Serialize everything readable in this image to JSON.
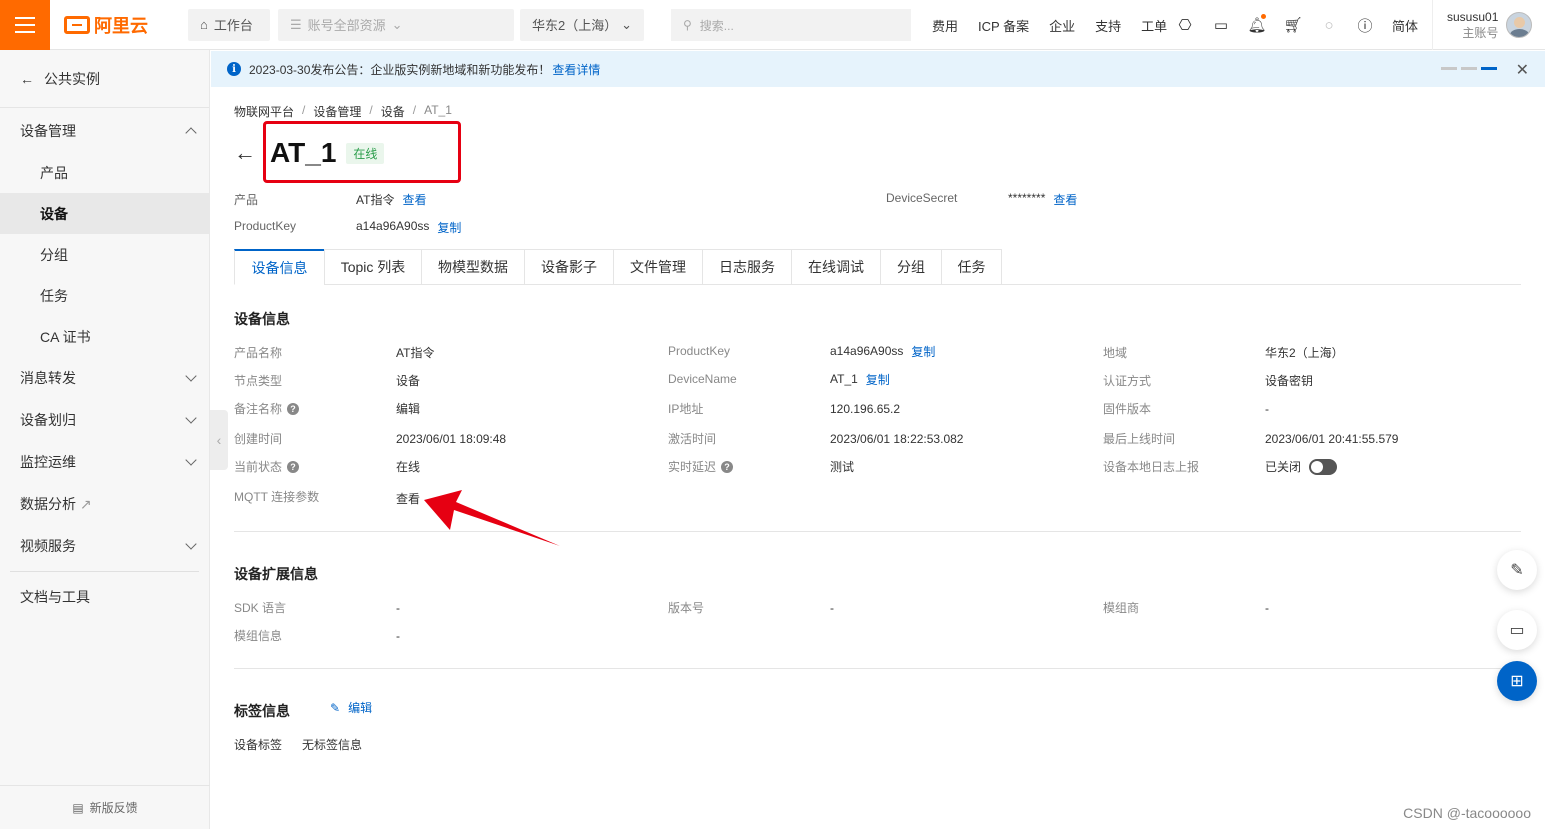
{
  "topbar": {
    "workspace": "工作台",
    "account_scope": "账号全部资源",
    "region": "华东2（上海）",
    "search_placeholder": "搜索...",
    "links": [
      "费用",
      "ICP 备案",
      "企业",
      "支持",
      "工单"
    ],
    "lang": "简体",
    "user_name": "sususu01",
    "user_role": "主账号",
    "logo_text": "阿里云"
  },
  "sidebar": {
    "back": "公共实例",
    "group_device": "设备管理",
    "items": [
      "产品",
      "设备",
      "分组",
      "任务",
      "CA 证书"
    ],
    "groups": [
      "消息转发",
      "设备划归",
      "监控运维",
      "数据分析",
      "视频服务"
    ],
    "docs": "文档与工具",
    "feedback": "新版反馈"
  },
  "notice": {
    "text": "2023-03-30发布公告：企业版实例新地域和新功能发布！",
    "link": "查看详情"
  },
  "breadcrumb": [
    "物联网平台",
    "设备管理",
    "设备",
    "AT_1"
  ],
  "device": {
    "name": "AT_1",
    "status": "在线",
    "product_label": "产品",
    "product_value": "AT指令",
    "product_link": "查看",
    "productkey_label": "ProductKey",
    "productkey_value": "a14a96A90ss",
    "copy": "复制",
    "secret_label": "DeviceSecret",
    "secret_value": "********",
    "secret_link": "查看"
  },
  "tabs": [
    "设备信息",
    "Topic 列表",
    "物模型数据",
    "设备影子",
    "文件管理",
    "日志服务",
    "在线调试",
    "分组",
    "任务"
  ],
  "info": {
    "title": "设备信息",
    "col1": [
      {
        "label": "产品名称",
        "value": "AT指令"
      },
      {
        "label": "节点类型",
        "value": "设备"
      },
      {
        "label": "备注名称",
        "value": "编辑"
      },
      {
        "label": "创建时间",
        "value": "2023/06/01 18:09:48"
      },
      {
        "label": "当前状态",
        "value": "在线"
      },
      {
        "label": "MQTT 连接参数",
        "value": "查看"
      }
    ],
    "col2": [
      {
        "label": "ProductKey",
        "value": "a14a96A90ss",
        "link": "复制"
      },
      {
        "label": "DeviceName",
        "value": "AT_1",
        "link": "复制"
      },
      {
        "label": "IP地址",
        "value": "120.196.65.2"
      },
      {
        "label": "激活时间",
        "value": "2023/06/01 18:22:53.082"
      },
      {
        "label": "实时延迟",
        "value": "测试"
      }
    ],
    "col3": [
      {
        "label": "地域",
        "value": "华东2（上海）"
      },
      {
        "label": "认证方式",
        "value": "设备密钥"
      },
      {
        "label": "固件版本",
        "value": "-"
      },
      {
        "label": "最后上线时间",
        "value": "2023/06/01 20:41:55.579"
      },
      {
        "label": "设备本地日志上报",
        "value": "已关闭"
      }
    ]
  },
  "ext": {
    "title": "设备扩展信息",
    "sdk_label": "SDK 语言",
    "sdk_value": "-",
    "version_label": "版本号",
    "version_value": "-",
    "module_vendor_label": "模组商",
    "module_vendor_value": "-",
    "module_info_label": "模组信息",
    "module_info_value": "-"
  },
  "tags": {
    "title": "标签信息",
    "edit": "编辑",
    "label": "设备标签",
    "value": "无标签信息"
  },
  "watermark": "CSDN @-tacoooooo",
  "colors": {
    "accent": "#0064c8",
    "brand": "#ff6a00",
    "online": "#2a9d4a",
    "highlight": "#e60012"
  }
}
